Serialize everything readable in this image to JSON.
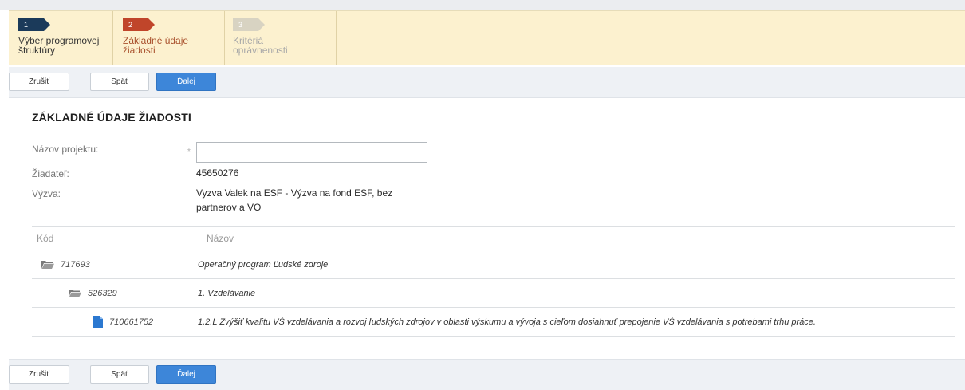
{
  "wizard": {
    "steps": [
      {
        "number": "1",
        "label": "Výber programovej štruktúry",
        "state": "done"
      },
      {
        "number": "2",
        "label": "Základné údaje žiadosti",
        "state": "active"
      },
      {
        "number": "3",
        "label": "Kritériá oprávnenosti",
        "state": "disabled"
      }
    ]
  },
  "buttons": {
    "cancel": "Zrušiť",
    "back": "Späť",
    "next": "Ďalej"
  },
  "form": {
    "title": "ZÁKLADNÉ ÚDAJE ŽIADOSTI",
    "project_name_label": "Názov projektu:",
    "project_name_value": "",
    "required_mark": "*",
    "applicant_label": "Žiadateľ:",
    "applicant_value": "45650276",
    "call_label": "Výzva:",
    "call_value": "Vyzva Valek na ESF - Výzva na fond ESF, bez partnerov a VO"
  },
  "table": {
    "headers": {
      "code": "Kód",
      "name": "Názov"
    },
    "rows": [
      {
        "code": "717693",
        "name": "Operačný program Ľudské zdroje",
        "icon": "folder-icon",
        "level": 0
      },
      {
        "code": "526329",
        "name": "1. Vzdelávanie",
        "icon": "folder-icon",
        "level": 1
      },
      {
        "code": "710661752",
        "name": "1.2.L Zvýšiť kvalitu VŠ vzdelávania a rozvoj ľudských zdrojov v oblasti výskumu a vývoja s cieľom dosiahnuť prepojenie VŠ vzdelávania s potrebami trhu práce.",
        "icon": "document-icon",
        "level": 2
      }
    ]
  },
  "colors": {
    "wizard_bg": "#fcf1cf",
    "step1": "#1b3a5a",
    "step2": "#c0452a",
    "step3": "#d8d3c2",
    "primary_button": "#3d86d9",
    "icon_color": "#2b78d0"
  }
}
